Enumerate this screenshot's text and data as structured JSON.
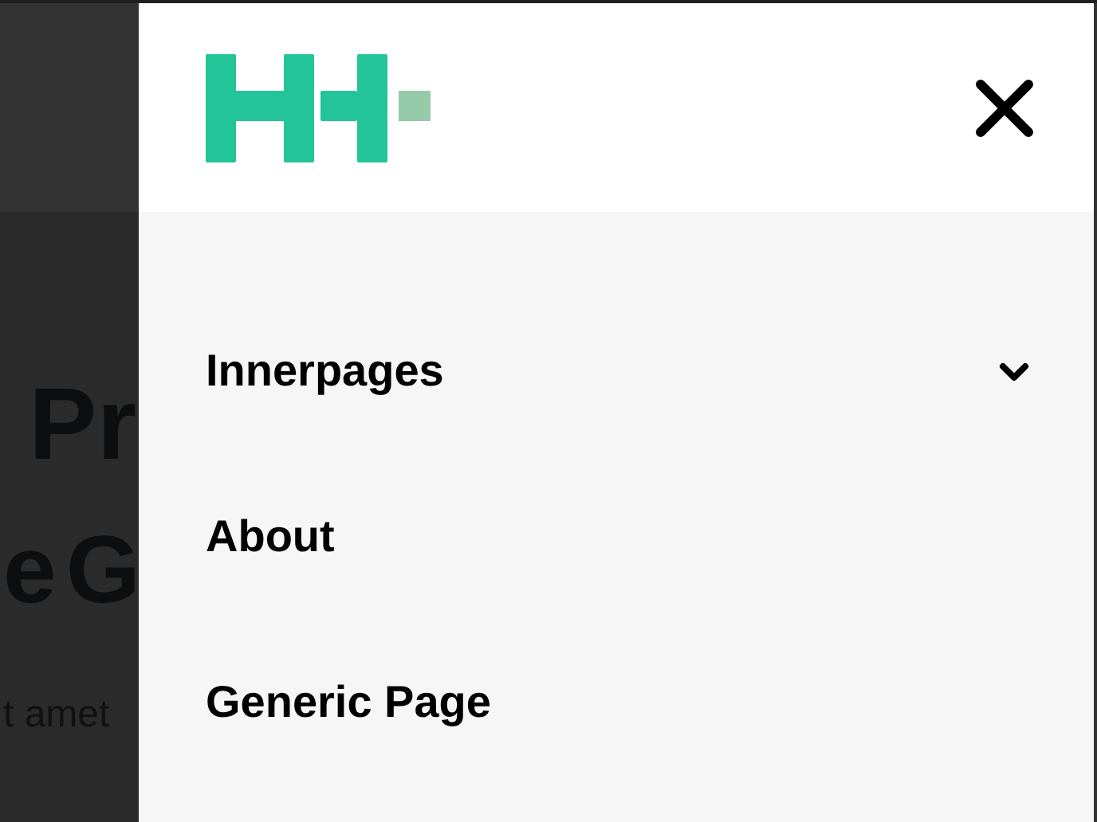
{
  "background_page": {
    "heading_line_1": "Pr",
    "heading_line_2_words": [
      "e",
      "G"
    ],
    "body_text": "t amet"
  },
  "menu": {
    "items": [
      {
        "label": "Innerpages",
        "kind": "submenu"
      },
      {
        "label": "About",
        "kind": "link"
      },
      {
        "label": "Generic Page",
        "kind": "link"
      }
    ]
  }
}
